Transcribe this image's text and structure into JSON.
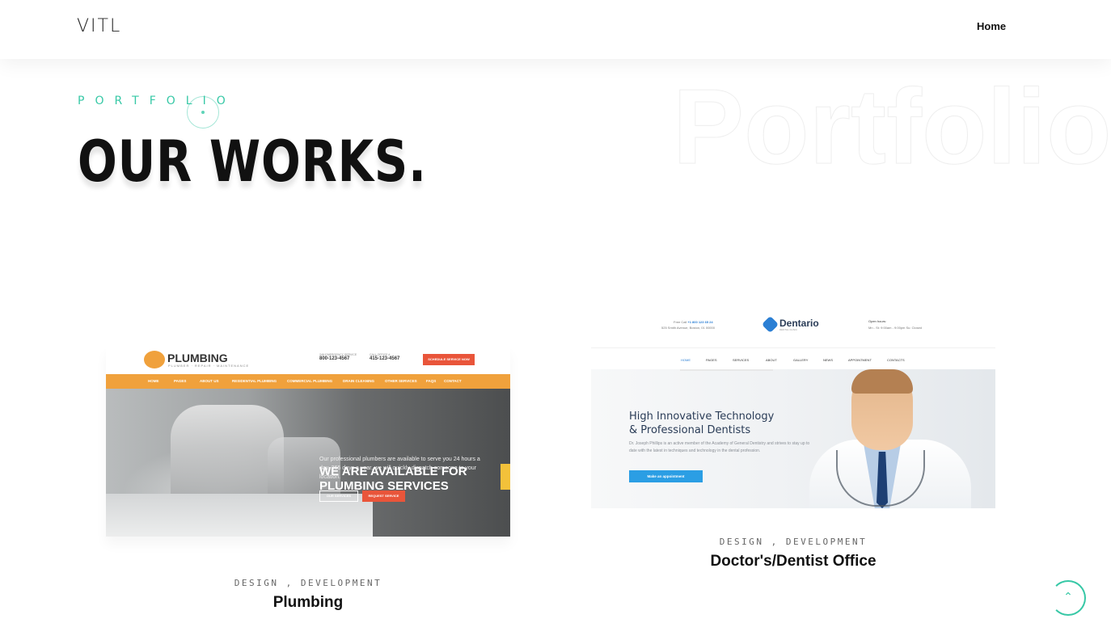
{
  "header": {
    "logo": "VITL",
    "nav": [
      {
        "label": "Home"
      }
    ]
  },
  "section": {
    "eyebrow": "PORTFOLIO",
    "title": "OUR WORKS.",
    "background_word": "Portfolio"
  },
  "projects": [
    {
      "categories": "DESIGN ,  DEVELOPMENT",
      "title": "Plumbing",
      "preview": {
        "logo": "PLUMBING",
        "logo_sub": "PLUMBER · REPAIR · MAINTENANCE",
        "phone1_label": "24H EMERGENCY SERVICE",
        "phone1": "800-123-4567",
        "phone2_label": "CALL OFFICE #",
        "phone2": "415-123-4567",
        "cta": "SCHEDULE SERVICE NOW",
        "nav": [
          "HOME",
          "PAGES",
          "ABOUT US",
          "RESIDENTIAL PLUMBING",
          "COMMERCIAL PLUMBING",
          "DRAIN CLEANING",
          "OTHER SERVICES",
          "FAQS",
          "CONTACT"
        ],
        "headline_1": "WE ARE AVAILABLE FOR",
        "headline_2": "PLUMBING SERVICES",
        "body": "Our professional plumbers are available to serve you 24 hours a day, 365 days a year, we will quickly dispatch someone to your location.",
        "button1": "OUR SERVICES",
        "button2": "REQUEST SERVICE"
      }
    },
    {
      "categories": "DESIGN ,  DEVELOPMENT",
      "title": "Doctor's/Dentist Office",
      "preview": {
        "free_call": "Free Call",
        "phone": "+1 800 123 65 24",
        "address": "525 Smith Avenue, Boston, 01 00000",
        "logo": "Dentario",
        "logo_sub": "DENTAL CLINIC",
        "hours_label": "Open hours:",
        "hours": "Mn - St: 9:00am - 9:00pm Su: Closed",
        "nav": [
          "HOME",
          "PAGES",
          "SERVICES",
          "ABOUT",
          "GALLERY",
          "NEWS",
          "APPOINTMENT",
          "CONTACTS"
        ],
        "headline_1": "High Innovative Technology",
        "headline_2": "& Professional Dentists",
        "body": "Dr. Joseph Phillips is an active member of the Academy of General Dentistry and strives to stay up to date with the latest in techniques and technology in the dental profession.",
        "button": "Make an appointment"
      }
    }
  ],
  "scroll_top": {
    "icon": "chevron-up-icon",
    "glyph": "⌃"
  },
  "colors": {
    "accent": "#37c8a6",
    "plumbing_orange": "#f0a13c",
    "plumbing_red": "#e9553a",
    "dentario_blue": "#2b7fd4"
  }
}
